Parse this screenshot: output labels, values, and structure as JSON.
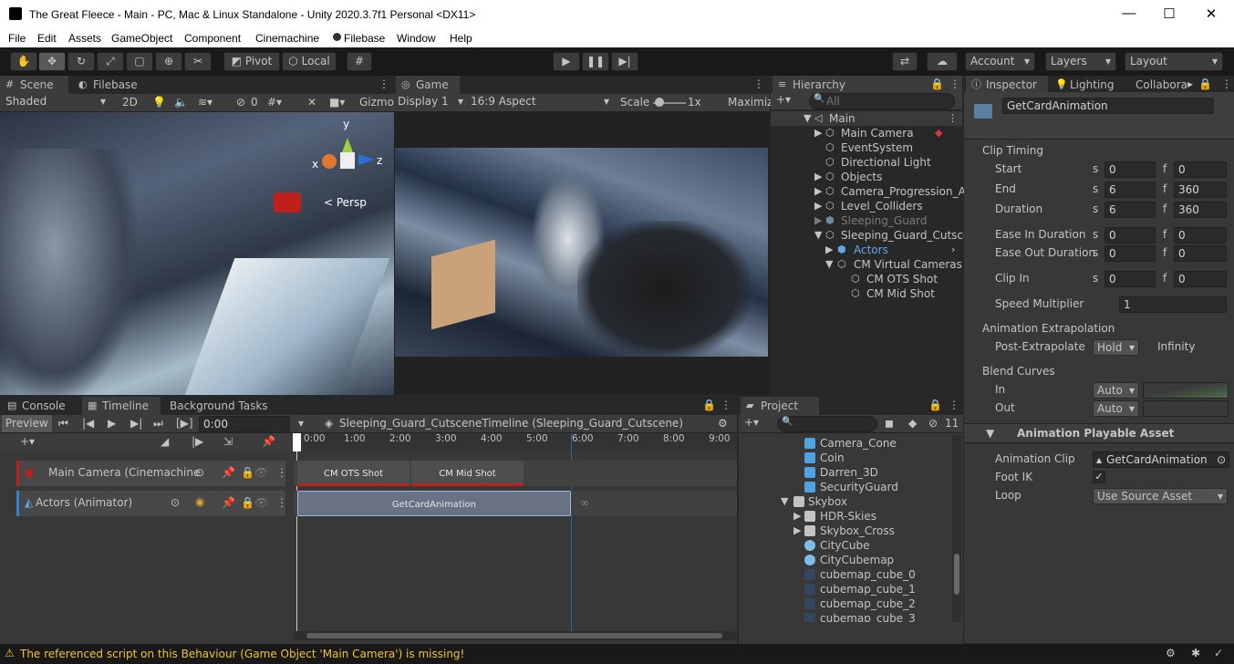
{
  "window": {
    "title": "The Great Fleece - Main - PC, Mac & Linux Standalone - Unity 2020.3.7f1 Personal <DX11>",
    "min": "—",
    "max": "☐",
    "close": "✕"
  },
  "menu": [
    "File",
    "Edit",
    "Assets",
    "GameObject",
    "Component",
    "Cinemachine",
    "Filebase",
    "Window",
    "Help"
  ],
  "toolbar": {
    "pivot": "Pivot",
    "local": "Local",
    "account": "Account",
    "layers": "Layers",
    "layout": "Layout"
  },
  "scene": {
    "tab1": "Scene",
    "tab2": "Filebase",
    "shading": "Shaded",
    "mode2d": "2D",
    "gizmos": "Gizmo",
    "persp": "< Persp",
    "axis_y": "y",
    "axis_x": "x",
    "axis_z": "z",
    "hidden_count": "0"
  },
  "game": {
    "tab": "Game",
    "display": "Display 1",
    "aspect": "16:9 Aspect",
    "scale_label": "Scale",
    "scale_value": "1x",
    "maximize": "Maximiz"
  },
  "hierarchy": {
    "tab": "Hierarchy",
    "search_placeholder": "All",
    "items": [
      {
        "label": "Main",
        "depth": 0
      },
      {
        "label": "Main Camera",
        "depth": 1
      },
      {
        "label": "EventSystem",
        "depth": 1
      },
      {
        "label": "Directional Light",
        "depth": 1
      },
      {
        "label": "Objects",
        "depth": 1
      },
      {
        "label": "Camera_Progression_Ar",
        "depth": 1
      },
      {
        "label": "Level_Colliders",
        "depth": 1
      },
      {
        "label": "Sleeping_Guard",
        "depth": 1
      },
      {
        "label": "Sleeping_Guard_Cutsce",
        "depth": 1
      },
      {
        "label": "Actors",
        "depth": 2
      },
      {
        "label": "CM Virtual Cameras",
        "depth": 2
      },
      {
        "label": "CM OTS Shot",
        "depth": 3
      },
      {
        "label": "CM Mid Shot",
        "depth": 3
      }
    ]
  },
  "inspector": {
    "tabs": [
      "Inspector",
      "Lighting",
      "Collabora"
    ],
    "name": "GetCardAnimation",
    "clip_timing": "Clip Timing",
    "rows": [
      {
        "label": "Start",
        "s": "0",
        "f": "0"
      },
      {
        "label": "End",
        "s": "6",
        "f": "360"
      },
      {
        "label": "Duration",
        "s": "6",
        "f": "360"
      },
      {
        "label": "Ease In Duration",
        "s": "0",
        "f": "0"
      },
      {
        "label": "Ease Out Duration",
        "s": "0",
        "f": "0"
      },
      {
        "label": "Clip In",
        "s": "0",
        "f": "0"
      }
    ],
    "s_label": "s",
    "f_label": "f",
    "speed_label": "Speed Multiplier",
    "speed_value": "1",
    "anim_extrap": "Animation Extrapolation",
    "post_extrap_label": "Post-Extrapolate",
    "post_extrap_value": "Hold",
    "infinity": "Infinity",
    "blend_curves": "Blend Curves",
    "in_label": "In",
    "in_value": "Auto",
    "out_label": "Out",
    "out_value": "Auto",
    "playable_header": "Animation Playable Asset",
    "anim_clip_label": "Animation Clip",
    "anim_clip_value": "GetCardAnimation",
    "footik_label": "Foot IK",
    "footik_check": "✓",
    "loop_label": "Loop",
    "loop_value": "Use Source Asset"
  },
  "timeline": {
    "tabs": [
      "Console",
      "Timeline",
      "Background Tasks"
    ],
    "preview": "Preview",
    "time": "0:00",
    "asset": "Sleeping_Guard_CutsceneTimeline (Sleeping_Guard_Cutscene)",
    "ruler": [
      "0:00",
      "1:00",
      "2:00",
      "3:00",
      "4:00",
      "5:00",
      "6:00",
      "7:00",
      "8:00",
      "9:00"
    ],
    "tracks": [
      {
        "label": "Main Camera (Cinemachine"
      },
      {
        "label": "Actors (Animator)"
      }
    ],
    "clips": {
      "ots": "CM OTS Shot",
      "mid": "CM Mid Shot",
      "anim": "GetCardAnimation"
    },
    "infinity_icon": "∞"
  },
  "project": {
    "tab": "Project",
    "count": "11",
    "items": [
      {
        "label": "Camera_Cone",
        "icon": "prefab-icon"
      },
      {
        "label": "Coin",
        "icon": "prefab-icon"
      },
      {
        "label": "Darren_3D",
        "icon": "prefab-icon"
      },
      {
        "label": "SecurityGuard",
        "icon": "prefab-icon"
      },
      {
        "label": "Skybox",
        "icon": "folder-icon"
      },
      {
        "label": "HDR-Skies",
        "icon": "folder-icon"
      },
      {
        "label": "Skybox_Cross",
        "icon": "folder-icon"
      },
      {
        "label": "CityCube",
        "icon": "material-icon"
      },
      {
        "label": "CityCubemap",
        "icon": "material-icon"
      },
      {
        "label": "cubemap_cube_0",
        "icon": "texture-icon"
      },
      {
        "label": "cubemap_cube_1",
        "icon": "texture-icon"
      },
      {
        "label": "cubemap_cube_2",
        "icon": "texture-icon"
      },
      {
        "label": "cubemap_cube_3",
        "icon": "texture-icon"
      }
    ]
  },
  "status": {
    "message": "The referenced script on this Behaviour (Game Object 'Main Camera') is missing!"
  }
}
